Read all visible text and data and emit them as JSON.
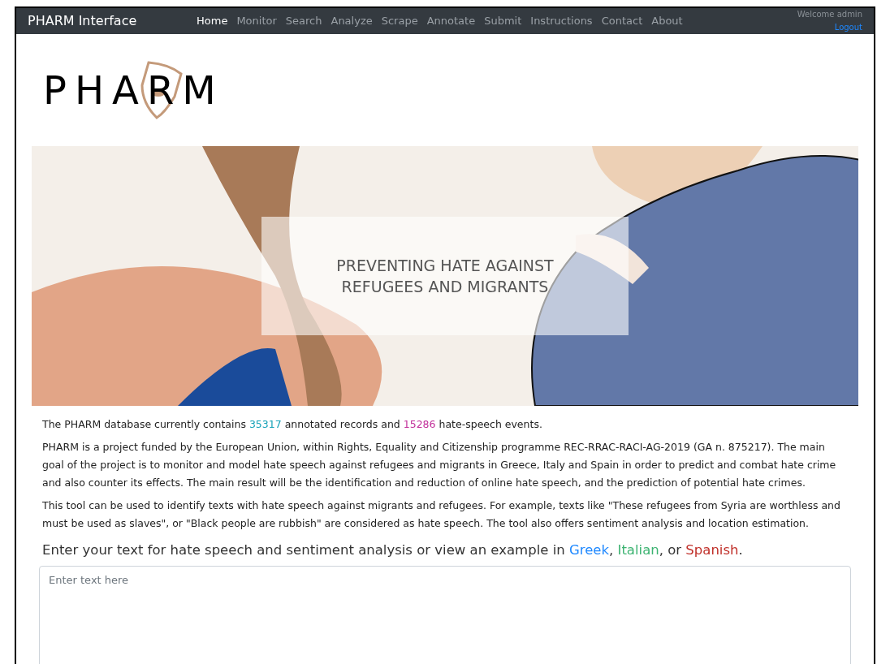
{
  "navbar": {
    "brand": "PHARM Interface",
    "links": [
      {
        "label": "Home",
        "selected": true
      },
      {
        "label": "Monitor",
        "selected": false
      },
      {
        "label": "Search",
        "selected": false
      },
      {
        "label": "Analyze",
        "selected": false
      },
      {
        "label": "Scrape",
        "selected": false
      },
      {
        "label": "Annotate",
        "selected": false
      },
      {
        "label": "Submit",
        "selected": false
      },
      {
        "label": "Instructions",
        "selected": false
      },
      {
        "label": "Contact",
        "selected": false
      },
      {
        "label": "About",
        "selected": false
      }
    ],
    "welcome": "Welcome admin",
    "logout": "Logout"
  },
  "logo": {
    "text": "PHARM"
  },
  "banner": {
    "caption_lines": [
      "PREVENTING HATE AGAINST",
      "REFUGEES AND MIGRANTS"
    ]
  },
  "stats": [
    {
      "text": "The PHARM database currently contains "
    },
    {
      "text": "35317",
      "color": "#17a2b8"
    },
    {
      "text": " annotated records and "
    },
    {
      "text": "15286",
      "color": "#c2309a"
    },
    {
      "text": " hate-speech events."
    }
  ],
  "paragraphs": [
    "PHARM is a project funded by the European Union, within Rights, Equality and Citizenship programme REC-RRAC-RACI-AG-2019 (GA n. 875217). The main goal of the project is to monitor and model hate speech against refugees and migrants in Greece, Italy and Spain in order to predict and combat hate crime and also counter its effects. The main result will be the identification and reduction of online hate speech, and the prediction of potential hate crimes.",
    "This tool can be used to identify texts with hate speech against migrants and refugees. For example, texts like \"These refugees from Syria are worthless and must be used as slaves\", or \"Black people are rubbish\" are considered as hate speech. The tool also offers sentiment analysis and location estimation."
  ],
  "prompt": {
    "text": "Enter your text for hate speech and sentiment analysis or view an example in ",
    "examples": [
      {
        "label": "Greek",
        "color": "#1e88ff"
      },
      {
        "label": "Italian",
        "color": "#3cb371"
      },
      {
        "label": "Spanish",
        "color": "#c0302a"
      }
    ],
    "separators": [
      ", ",
      ", or ",
      "."
    ]
  },
  "textarea": {
    "placeholder": "Enter text here"
  }
}
